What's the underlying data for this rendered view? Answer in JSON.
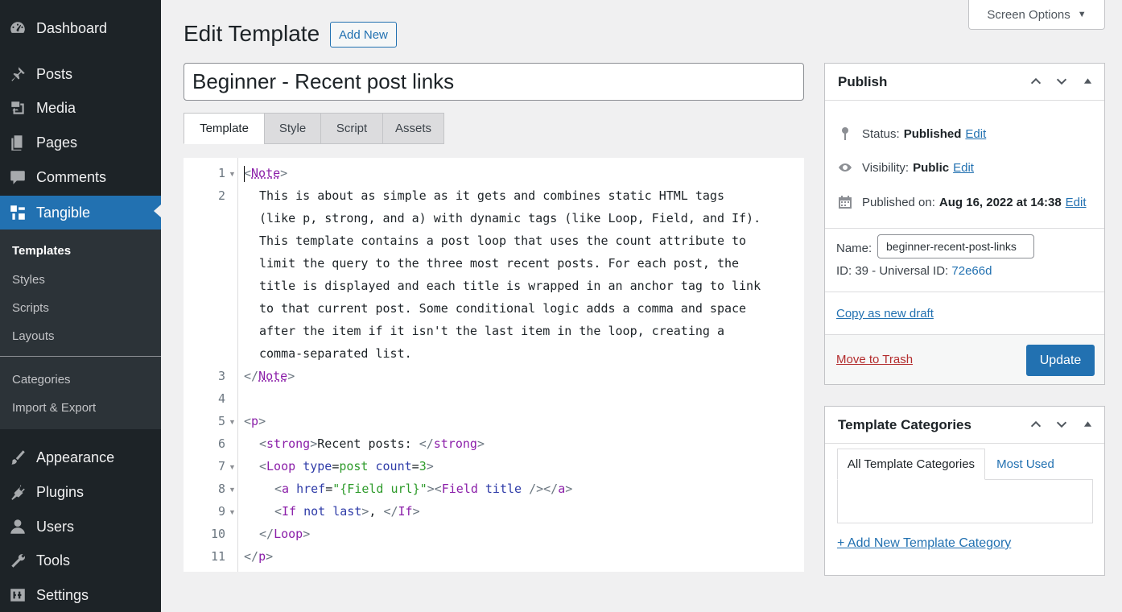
{
  "sidebar": {
    "menu": [
      {
        "label": "Dashboard",
        "icon": "dashboard-icon"
      },
      {
        "label": "Posts",
        "icon": "pin-icon"
      },
      {
        "label": "Media",
        "icon": "media-icon"
      },
      {
        "label": "Pages",
        "icon": "pages-icon"
      },
      {
        "label": "Comments",
        "icon": "comment-icon"
      },
      {
        "label": "Tangible",
        "icon": "tangible-icon"
      },
      {
        "label": "Appearance",
        "icon": "brush-icon"
      },
      {
        "label": "Plugins",
        "icon": "plug-icon"
      },
      {
        "label": "Users",
        "icon": "user-icon"
      },
      {
        "label": "Tools",
        "icon": "wrench-icon"
      },
      {
        "label": "Settings",
        "icon": "settings-icon"
      }
    ],
    "submenu": [
      "Templates",
      "Styles",
      "Scripts",
      "Layouts",
      "Categories",
      "Import & Export"
    ]
  },
  "header": {
    "title": "Edit Template",
    "add_new": "Add New",
    "screen_options": "Screen Options"
  },
  "title_input": {
    "value": "Beginner - Recent post links"
  },
  "tabs": [
    "Template",
    "Style",
    "Script",
    "Assets"
  ],
  "editor": {
    "line_numbers": [
      "1",
      "2",
      "3",
      "4",
      "5",
      "6",
      "7",
      "8",
      "9",
      "10",
      "11"
    ],
    "lines": {
      "note_open": "Note",
      "note_text": [
        "This is about as simple as it gets and combines static HTML tags",
        "(like p, strong, and a) with dynamic tags (like Loop, Field, and If).",
        "This template contains a post loop that uses the count attribute to",
        "limit the query to the three most recent posts. For each post, the",
        "title is displayed and each title is wrapped in an anchor tag to link",
        "to that current post. Some conditional logic adds a comma and space",
        "after the item if it isn't the last item in the loop, creating a",
        "comma-separated list."
      ],
      "note_close": "Note",
      "p": "p",
      "strong": "strong",
      "strong_text": "Recent posts: ",
      "loop": "Loop",
      "type_attr": "type",
      "type_val": "post",
      "count_attr": "count",
      "count_val": "3",
      "a": "a",
      "href_attr": "href",
      "href_val": "\"{Field url}\"",
      "field": "Field",
      "title_attr": "title",
      "if": "If",
      "not_attr": "not",
      "last_attr": "last",
      "if_text": ", "
    }
  },
  "publish": {
    "heading": "Publish",
    "status_label": "Status:",
    "status_value": "Published",
    "visibility_label": "Visibility:",
    "visibility_value": "Public",
    "published_label": "Published on:",
    "published_value": "Aug 16, 2022 at 14:38",
    "edit": "Edit",
    "name_label": "Name:",
    "name_value": "beginner-recent-post-links",
    "id_text": "ID: 39 - Universal ID:",
    "universal_id": "72e66d",
    "copy_draft": "Copy as new draft",
    "trash": "Move to Trash",
    "update": "Update"
  },
  "categories": {
    "heading": "Template Categories",
    "tab_all": "All Template Categories",
    "tab_most": "Most Used",
    "add_new": "+ Add New Template Category"
  },
  "colors": {
    "accent": "#2271b1",
    "sidebar": "#1d2327",
    "danger": "#b32d2e"
  }
}
